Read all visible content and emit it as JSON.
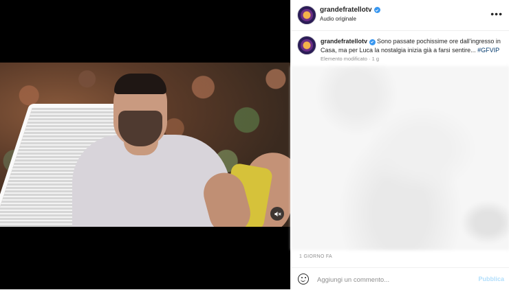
{
  "header": {
    "username": "grandefratellotv",
    "subtitle": "Audio originale",
    "more_icon": "more-horizontal-icon"
  },
  "caption": {
    "username": "grandefratellotv",
    "text": "Sono passate pochissime ore dall'ingresso in Casa, ma per Luca la nostalgia inizia già a farsi sentire...",
    "hashtag": "#GFVIP",
    "meta": "Elemento modificato · 1 g"
  },
  "post": {
    "timestamp": "1 GIORNO FA"
  },
  "composer": {
    "placeholder": "Aggiungi un commento...",
    "publish_label": "Pubblica",
    "emoji_icon": "emoji-smile-icon"
  },
  "video": {
    "mute_icon": "speaker-muted-icon"
  },
  "colors": {
    "link": "#00376b",
    "verified": "#3897f0",
    "publish_disabled": "#b2dffc",
    "muted_text": "#8e8e8e"
  }
}
